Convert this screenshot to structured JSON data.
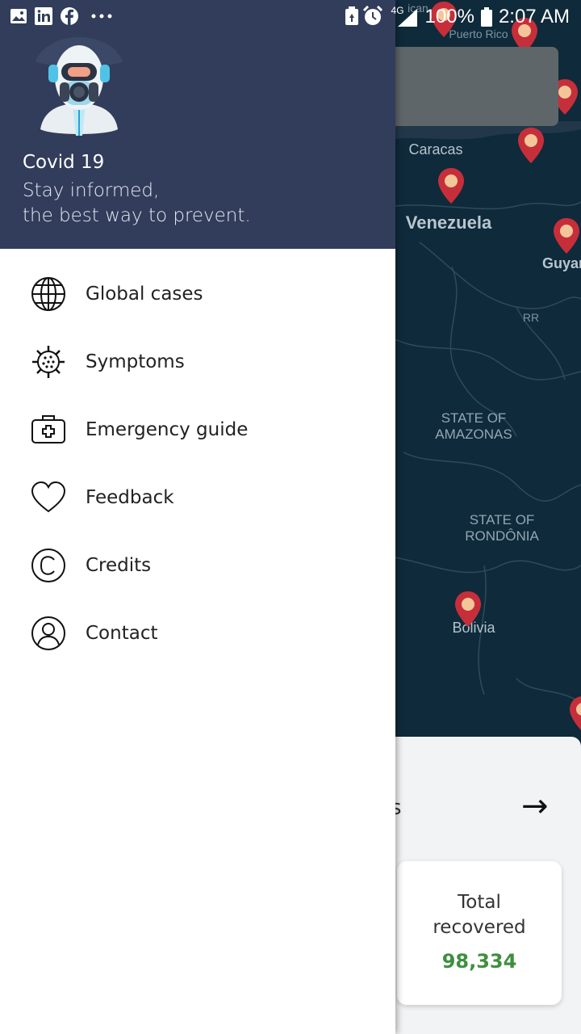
{
  "status_bar": {
    "network": "4G",
    "battery": "100%",
    "time": "2:07 AM",
    "left_icons": [
      "gallery-icon",
      "linkedin-icon",
      "facebook-icon",
      "more-dots-icon"
    ],
    "right_icons": [
      "battery-saver-icon",
      "alarm-icon",
      "signal-icon",
      "battery-icon"
    ]
  },
  "drawer": {
    "header": {
      "title": "Covid 19",
      "subtitle_line1": "Stay informed,",
      "subtitle_line2": "the best way to prevent.",
      "background_color": "#323d5c",
      "avatar_icon": "hazmat-person-icon"
    },
    "menu": [
      {
        "label": "Global cases",
        "icon": "globe-icon"
      },
      {
        "label": "Symptoms",
        "icon": "virus-icon"
      },
      {
        "label": "Emergency guide",
        "icon": "first-aid-kit-icon"
      },
      {
        "label": "Feedback",
        "icon": "heart-icon"
      },
      {
        "label": "Credits",
        "icon": "copyright-icon"
      },
      {
        "label": "Contact",
        "icon": "user-circle-icon"
      }
    ]
  },
  "map": {
    "labels": {
      "puerto_rico": "Puerto Rico",
      "caracas": "Caracas",
      "venezuela": "Venezuela",
      "guyana": "Guyar",
      "rr": "RR",
      "amazonas": "STATE OF AMAZONAS",
      "rondonia": "STATE OF RONDÔNIA",
      "bolivia": "Bolivia",
      "top_partial": "ican"
    },
    "pin_color": "#c62f3a"
  },
  "bottom_sheet": {
    "title_partial": "s",
    "arrow": "→",
    "recovered_label": "Total recovered",
    "recovered_value": "98,334",
    "recovered_color": "#3f8f3f"
  }
}
